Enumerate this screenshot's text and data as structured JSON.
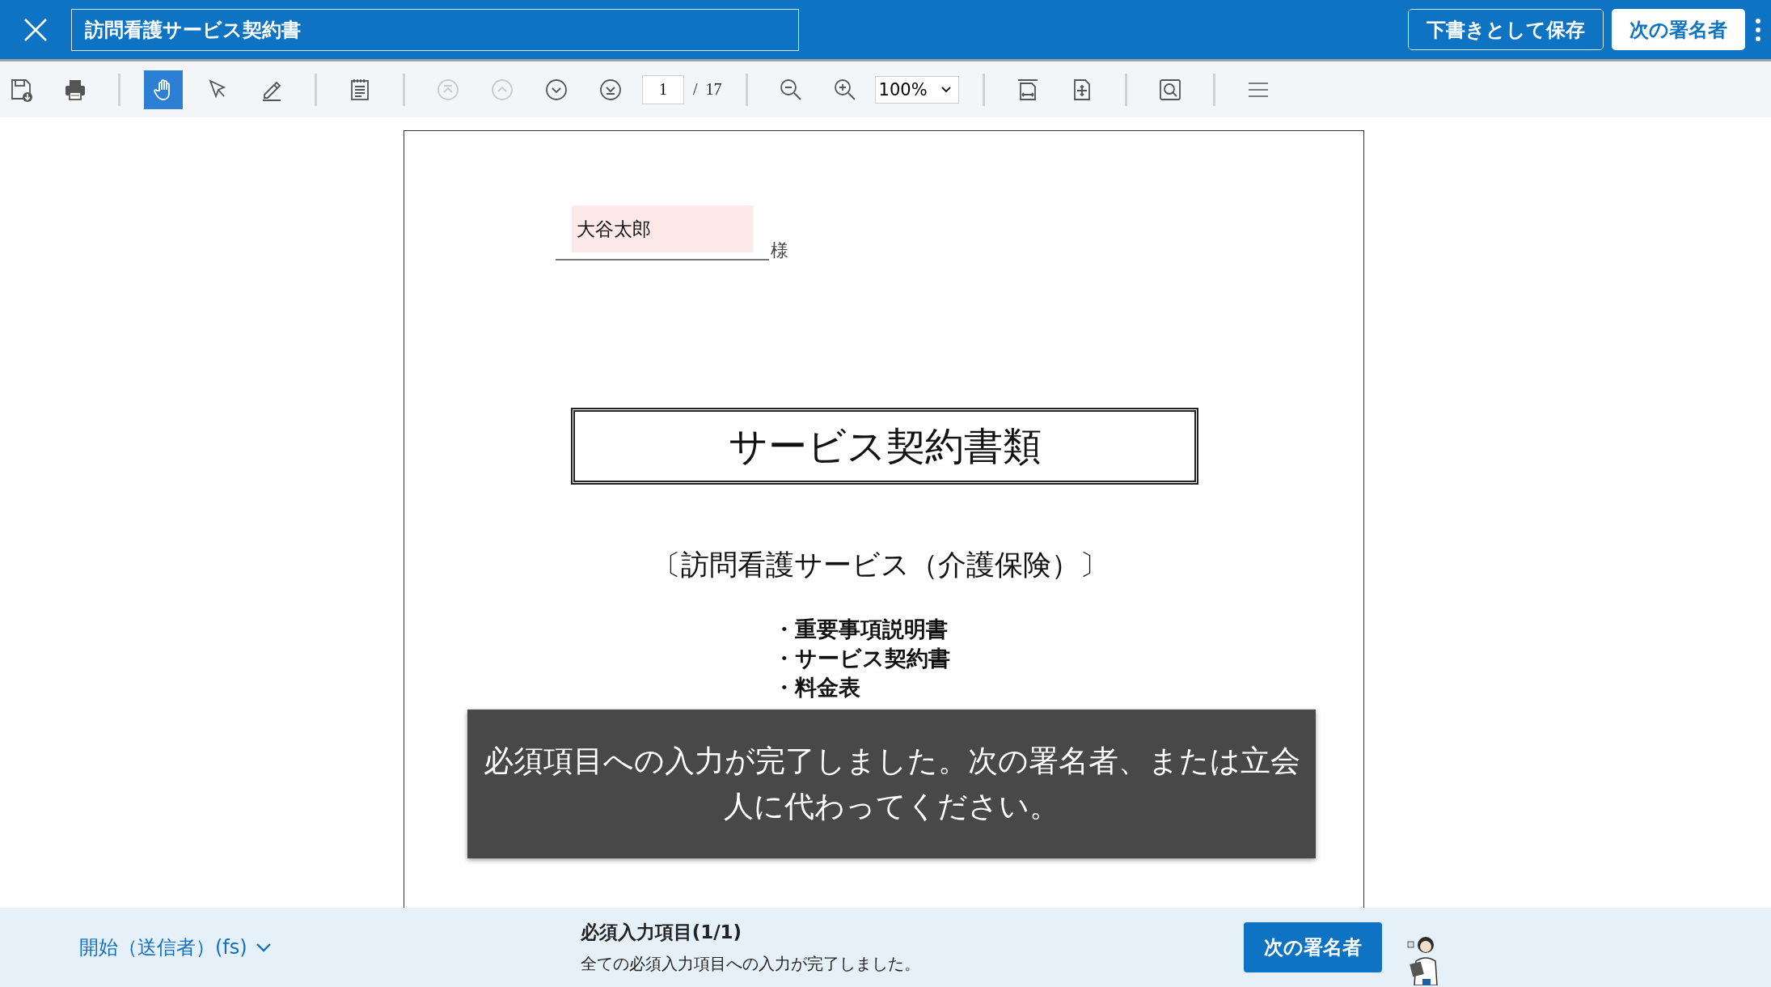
{
  "header": {
    "document_title": "訪問看護サービス契約書",
    "save_draft_button": "下書きとして保存",
    "next_signer_button": "次の署名者"
  },
  "toolbar": [
    {
      "kind": "tool",
      "selected": false,
      "disabled": false
    },
    {
      "kind": "tool",
      "selected": false,
      "disabled": false
    },
    {
      "kind": "separator"
    },
    {
      "kind": "tool",
      "selected": true,
      "disabled": false
    },
    {
      "kind": "tool",
      "selected": false,
      "disabled": false
    },
    {
      "kind": "tool",
      "selected": false,
      "disabled": false
    },
    {
      "kind": "separator"
    },
    {
      "kind": "tool",
      "selected": false,
      "disabled": false
    },
    {
      "kind": "separator"
    },
    {
      "kind": "tool",
      "selected": false,
      "disabled": true
    },
    {
      "kind": "tool",
      "selected": false,
      "disabled": true
    },
    {
      "kind": "tool",
      "selected": false,
      "disabled": false
    },
    {
      "kind": "tool",
      "selected": false,
      "disabled": false
    },
    {
      "kind": "page",
      "value": "1",
      "total": "/  17"
    },
    {
      "kind": "separator"
    },
    {
      "kind": "tool",
      "selected": false,
      "disabled": false
    },
    {
      "kind": "tool",
      "selected": false,
      "disabled": false
    },
    {
      "kind": "zoom",
      "value": "100%"
    },
    {
      "kind": "separator"
    },
    {
      "kind": "tool",
      "selected": false,
      "disabled": false
    },
    {
      "kind": "tool",
      "selected": false,
      "disabled": false
    },
    {
      "kind": "separator"
    },
    {
      "kind": "tool",
      "selected": false,
      "disabled": false
    },
    {
      "kind": "separator"
    },
    {
      "kind": "tool",
      "selected": false,
      "disabled": false
    }
  ],
  "document": {
    "name_field": {
      "value": "大谷太郎"
    },
    "honorific": "様",
    "title": "サービス契約書類",
    "subtitle": "〔訪問看護サービス（介護保険）〕",
    "contents": [
      "・重要事項説明書",
      "・サービス契約書",
      "・料金表"
    ]
  },
  "toast": "必須項目への入力が完了しました。次の署名者、または立会人に代わってください。",
  "footer": {
    "signer_menu": "開始（送信者）(fs)",
    "required_title": "必須入力項目(1/1)",
    "required_status": "全ての必須入力項目への入力が完了しました。",
    "next_signer_button": "次の署名者"
  }
}
